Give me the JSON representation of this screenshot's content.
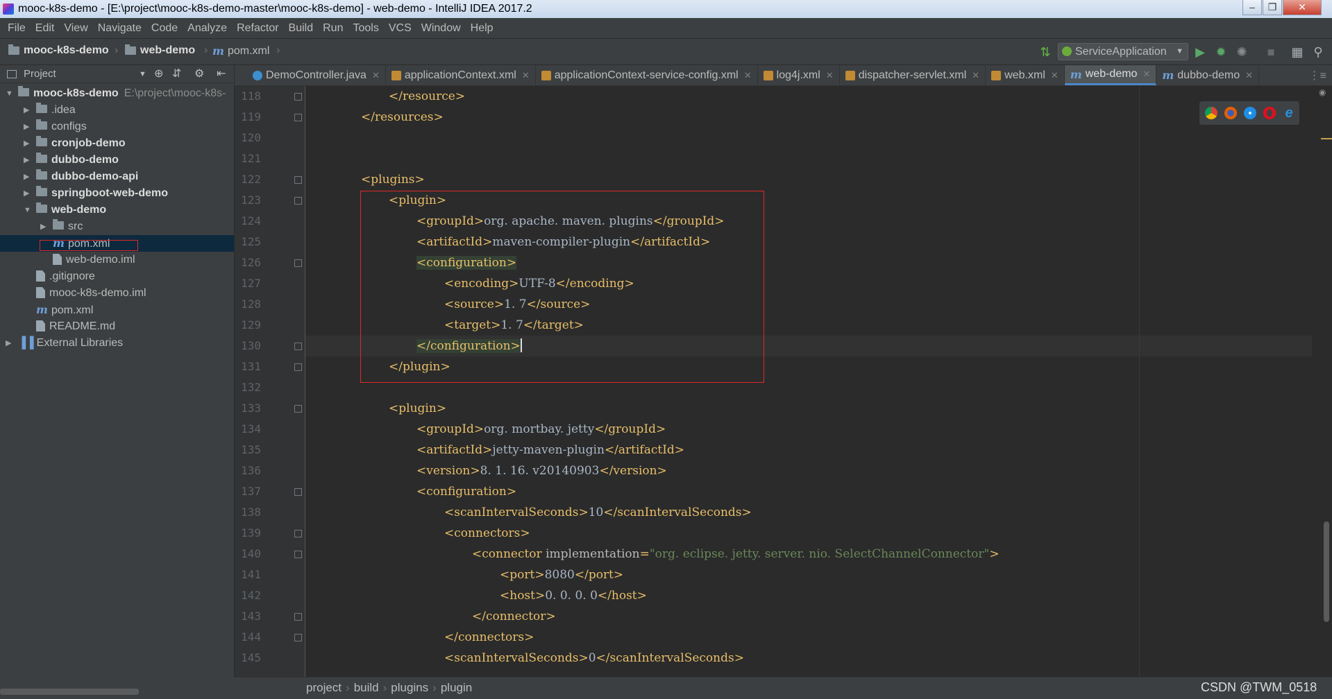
{
  "window": {
    "title": "mooc-k8s-demo - [E:\\project\\mooc-k8s-demo-master\\mooc-k8s-demo] - web-demo - IntelliJ IDEA 2017.2"
  },
  "menu": [
    "File",
    "Edit",
    "View",
    "Navigate",
    "Code",
    "Analyze",
    "Refactor",
    "Build",
    "Run",
    "Tools",
    "VCS",
    "Window",
    "Help"
  ],
  "nav": {
    "crumb1": "mooc-k8s-demo",
    "crumb2": "web-demo",
    "crumb3": "pom.xml",
    "run_config": "ServiceApplication"
  },
  "project_panel": {
    "header": "Project",
    "items": [
      {
        "label": "mooc-k8s-demo",
        "extra": "E:\\project\\mooc-k8s-"
      },
      {
        "label": ".idea"
      },
      {
        "label": "configs"
      },
      {
        "label": "cronjob-demo"
      },
      {
        "label": "dubbo-demo"
      },
      {
        "label": "dubbo-demo-api"
      },
      {
        "label": "springboot-web-demo"
      },
      {
        "label": "web-demo"
      },
      {
        "label": "src"
      },
      {
        "label": "pom.xml"
      },
      {
        "label": "web-demo.iml"
      },
      {
        "label": ".gitignore"
      },
      {
        "label": "mooc-k8s-demo.iml"
      },
      {
        "label": "pom.xml"
      },
      {
        "label": "README.md"
      },
      {
        "label": "External Libraries"
      }
    ]
  },
  "tabs": [
    "DemoController.java",
    "applicationContext.xml",
    "applicationContext-service-config.xml",
    "log4j.xml",
    "dispatcher-servlet.xml",
    "web.xml",
    "web-demo",
    "dubbo-demo"
  ],
  "editor": {
    "line_numbers": [
      "118",
      "119",
      "120",
      "121",
      "122",
      "123",
      "124",
      "125",
      "126",
      "127",
      "128",
      "129",
      "130",
      "131",
      "132",
      "133",
      "134",
      "135",
      "136",
      "137",
      "138",
      "139",
      "140",
      "141",
      "142",
      "143",
      "144",
      "145"
    ],
    "lines": [
      {
        "indent": 1,
        "parts": [
          [
            "tag",
            "</resource>"
          ]
        ]
      },
      {
        "indent": 0,
        "parts": [
          [
            "tag",
            "</resources>"
          ]
        ]
      },
      {
        "indent": 0,
        "parts": []
      },
      {
        "indent": 0,
        "parts": []
      },
      {
        "indent": 0,
        "parts": [
          [
            "tag",
            "<plugins>"
          ]
        ]
      },
      {
        "indent": 1,
        "parts": [
          [
            "tag",
            "<plugin>"
          ]
        ]
      },
      {
        "indent": 2,
        "parts": [
          [
            "tag",
            "<groupId>"
          ],
          [
            "text",
            "org. apache. maven. plugins"
          ],
          [
            "tag",
            "</groupId>"
          ]
        ]
      },
      {
        "indent": 2,
        "parts": [
          [
            "tag",
            "<artifactId>"
          ],
          [
            "text",
            "maven-compiler-plugin"
          ],
          [
            "tag",
            "</artifactId>"
          ]
        ]
      },
      {
        "indent": 2,
        "parts": [
          [
            "taghl",
            "<configuration>"
          ]
        ]
      },
      {
        "indent": 3,
        "parts": [
          [
            "tag",
            "<encoding>"
          ],
          [
            "text",
            "UTF-8"
          ],
          [
            "tag",
            "</encoding>"
          ]
        ]
      },
      {
        "indent": 3,
        "parts": [
          [
            "tag",
            "<source>"
          ],
          [
            "text",
            "1. 7"
          ],
          [
            "tag",
            "</source>"
          ]
        ]
      },
      {
        "indent": 3,
        "parts": [
          [
            "tag",
            "<target>"
          ],
          [
            "text",
            "1. 7"
          ],
          [
            "tag",
            "</target>"
          ]
        ]
      },
      {
        "indent": 2,
        "parts": [
          [
            "taghl",
            "</configuration>"
          ]
        ]
      },
      {
        "indent": 1,
        "parts": [
          [
            "tag",
            "</plugin>"
          ]
        ]
      },
      {
        "indent": 0,
        "parts": []
      },
      {
        "indent": 1,
        "parts": [
          [
            "tag",
            "<plugin>"
          ]
        ]
      },
      {
        "indent": 2,
        "parts": [
          [
            "tag",
            "<groupId>"
          ],
          [
            "text",
            "org. mortbay. jetty"
          ],
          [
            "tag",
            "</groupId>"
          ]
        ]
      },
      {
        "indent": 2,
        "parts": [
          [
            "tag",
            "<artifactId>"
          ],
          [
            "text",
            "jetty-maven-plugin"
          ],
          [
            "tag",
            "</artifactId>"
          ]
        ]
      },
      {
        "indent": 2,
        "parts": [
          [
            "tag",
            "<version>"
          ],
          [
            "text",
            "8. 1. 16. v20140903"
          ],
          [
            "tag",
            "</version>"
          ]
        ]
      },
      {
        "indent": 2,
        "parts": [
          [
            "tag",
            "<configuration>"
          ]
        ]
      },
      {
        "indent": 3,
        "parts": [
          [
            "tag",
            "<scanIntervalSeconds>"
          ],
          [
            "text",
            "10"
          ],
          [
            "tag",
            "</scanIntervalSeconds>"
          ]
        ]
      },
      {
        "indent": 3,
        "parts": [
          [
            "tag",
            "<connectors>"
          ]
        ]
      },
      {
        "indent": 4,
        "parts": [
          [
            "tag",
            "<connector "
          ],
          [
            "attr",
            "implementation"
          ],
          [
            "tag",
            "="
          ],
          [
            "val",
            "\"org. eclipse. jetty. server. nio. SelectChannelConnector\""
          ],
          [
            "tag",
            ">"
          ]
        ]
      },
      {
        "indent": 5,
        "parts": [
          [
            "tag",
            "<port>"
          ],
          [
            "text",
            "8080"
          ],
          [
            "tag",
            "</port>"
          ]
        ]
      },
      {
        "indent": 5,
        "parts": [
          [
            "tag",
            "<host>"
          ],
          [
            "text",
            "0. 0. 0. 0"
          ],
          [
            "tag",
            "</host>"
          ]
        ]
      },
      {
        "indent": 4,
        "parts": [
          [
            "tag",
            "</connector>"
          ]
        ]
      },
      {
        "indent": 3,
        "parts": [
          [
            "tag",
            "</connectors>"
          ]
        ]
      },
      {
        "indent": 3,
        "parts": [
          [
            "tag",
            "<scanIntervalSeconds>"
          ],
          [
            "text",
            "0"
          ],
          [
            "tag",
            "</scanIntervalSeconds>"
          ]
        ]
      }
    ]
  },
  "status_breadcrumb": [
    "project",
    "build",
    "plugins",
    "plugin"
  ],
  "watermark": "CSDN @TWM_0518",
  "colors": {
    "tag": "#e8bf6a",
    "text": "#a9b7c6",
    "string": "#6a8759",
    "highlight_box": "#e02828",
    "active_tab": "#4a88c7"
  }
}
